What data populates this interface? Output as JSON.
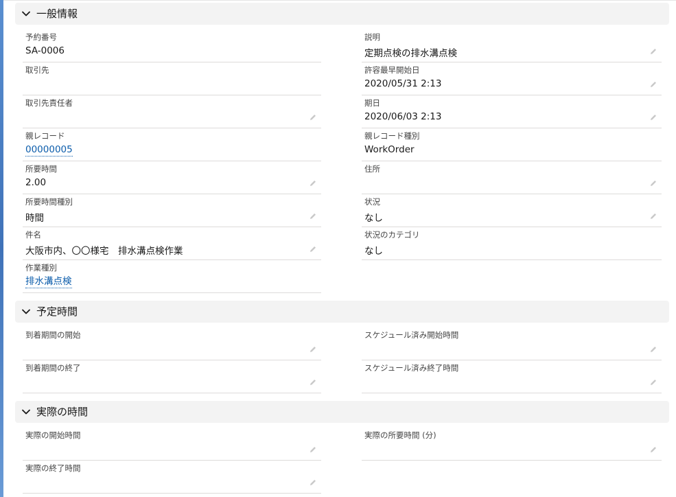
{
  "sections": [
    {
      "title": "一般情報",
      "fields": [
        {
          "label": "予約番号",
          "value": "SA-0006",
          "editable": false,
          "link": false
        },
        {
          "label": "説明",
          "value": "定期点検の排水溝点検",
          "editable": true,
          "link": false
        },
        {
          "label": "取引先",
          "value": "",
          "editable": false,
          "link": false
        },
        {
          "label": "許容最早開始日",
          "value": "2020/05/31 2:13",
          "editable": true,
          "link": false
        },
        {
          "label": "取引先責任者",
          "value": "",
          "editable": true,
          "link": false
        },
        {
          "label": "期日",
          "value": "2020/06/03 2:13",
          "editable": true,
          "link": false
        },
        {
          "label": "親レコード",
          "value": "00000005",
          "editable": false,
          "link": true
        },
        {
          "label": "親レコード種別",
          "value": "WorkOrder",
          "editable": false,
          "link": false
        },
        {
          "label": "所要時間",
          "value": "2.00",
          "editable": true,
          "link": false
        },
        {
          "label": "住所",
          "value": "",
          "editable": true,
          "link": false
        },
        {
          "label": "所要時間種別",
          "value": "時間",
          "editable": true,
          "link": false
        },
        {
          "label": "状況",
          "value": "なし",
          "editable": true,
          "link": false
        },
        {
          "label": "件名",
          "value": "大阪市内、〇〇様宅　排水溝点検作業",
          "editable": true,
          "link": false
        },
        {
          "label": "状況のカテゴリ",
          "value": "なし",
          "editable": false,
          "link": false
        },
        {
          "label": "作業種別",
          "value": "排水溝点検",
          "editable": false,
          "link": true
        }
      ]
    },
    {
      "title": "予定時間",
      "fields": [
        {
          "label": "到着期間の開始",
          "value": "",
          "editable": true,
          "link": false
        },
        {
          "label": "スケジュール済み開始時間",
          "value": "",
          "editable": true,
          "link": false
        },
        {
          "label": "到着期間の終了",
          "value": "",
          "editable": true,
          "link": false
        },
        {
          "label": "スケジュール済み終了時間",
          "value": "",
          "editable": true,
          "link": false
        }
      ]
    },
    {
      "title": "実際の時間",
      "fields": [
        {
          "label": "実際の開始時間",
          "value": "",
          "editable": true,
          "link": false
        },
        {
          "label": "実際の所要時間 (分)",
          "value": "",
          "editable": true,
          "link": false
        },
        {
          "label": "実際の終了時間",
          "value": "",
          "editable": true,
          "link": false
        }
      ]
    }
  ],
  "icons": {
    "section_toggle": "chevron-down-icon",
    "edit": "pencil-icon"
  },
  "colors": {
    "link": "#0b5cab",
    "section_header_bg": "#f3f3f3",
    "divider": "#dddbda"
  }
}
